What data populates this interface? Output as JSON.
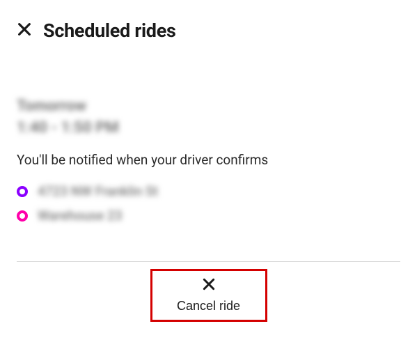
{
  "header": {
    "title": "Scheduled rides"
  },
  "ride": {
    "date": "Tomorrow",
    "time_window": "1:40 - 1:50 PM",
    "status_text": "You'll be notified when your driver confirms",
    "pickup_address": "4723 NW Franklin St",
    "dropoff_address": "Warehouse 23"
  },
  "footer": {
    "cancel_label": "Cancel ride"
  },
  "colors": {
    "pickup_dot": "#8b00ff",
    "dropoff_dot": "#ff00aa",
    "highlight_border": "#d40000"
  }
}
